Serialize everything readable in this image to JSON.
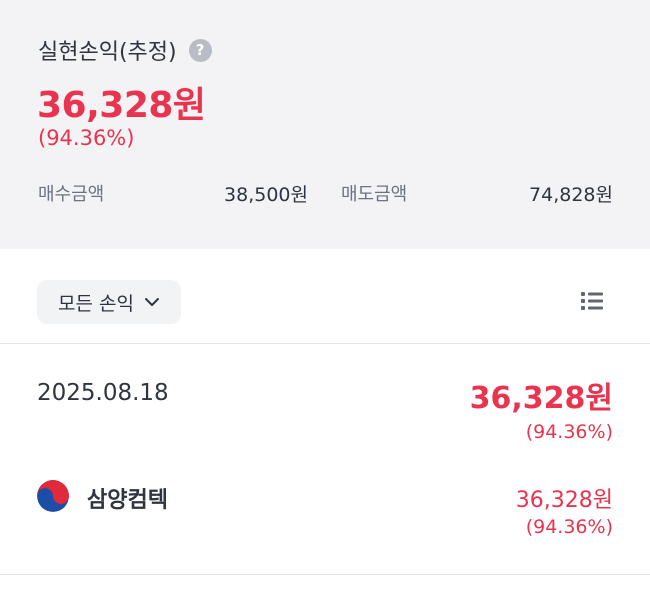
{
  "summary": {
    "title": "실현손익(추정)",
    "help_symbol": "?",
    "amount": "36,328원",
    "percent": "(94.36%)",
    "buy_label": "매수금액",
    "buy_value": "38,500원",
    "sell_label": "매도금액",
    "sell_value": "74,828원"
  },
  "filter": {
    "label": "모든 손익"
  },
  "group": {
    "date": "2025.08.18",
    "amount": "36,328원",
    "percent": "(94.36%)"
  },
  "stock": {
    "name": "삼양컴텍",
    "amount": "36,328원",
    "percent": "(94.36%)",
    "flag_icon": "korea-flag-icon"
  },
  "colors": {
    "profit": "#e8344e",
    "summary_bg": "#f3f3f5",
    "text": "#2f3540"
  },
  "icons": [
    "help-icon",
    "chevron-down-icon",
    "list-view-icon",
    "korea-flag-icon"
  ]
}
